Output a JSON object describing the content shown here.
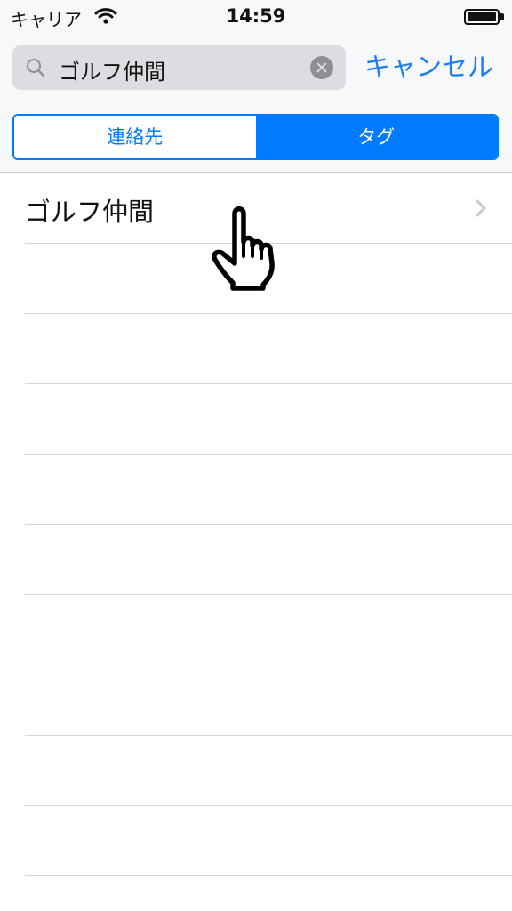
{
  "status_bar": {
    "carrier": "キャリア",
    "time": "14:59"
  },
  "search": {
    "query": "ゴルフ仲間",
    "cancel_label": "キャンセル"
  },
  "segments": [
    {
      "label": "連絡先",
      "selected": false
    },
    {
      "label": "タグ",
      "selected": true
    }
  ],
  "results": [
    {
      "label": "ゴルフ仲間"
    }
  ],
  "colors": {
    "accent": "#007aff",
    "cancel_text": "#1a7cf5",
    "separator": "#d6d6da"
  },
  "icons": [
    "wifi-icon",
    "battery-icon",
    "search-icon",
    "clear-icon",
    "chevron-right-icon",
    "pointing-hand-icon"
  ]
}
